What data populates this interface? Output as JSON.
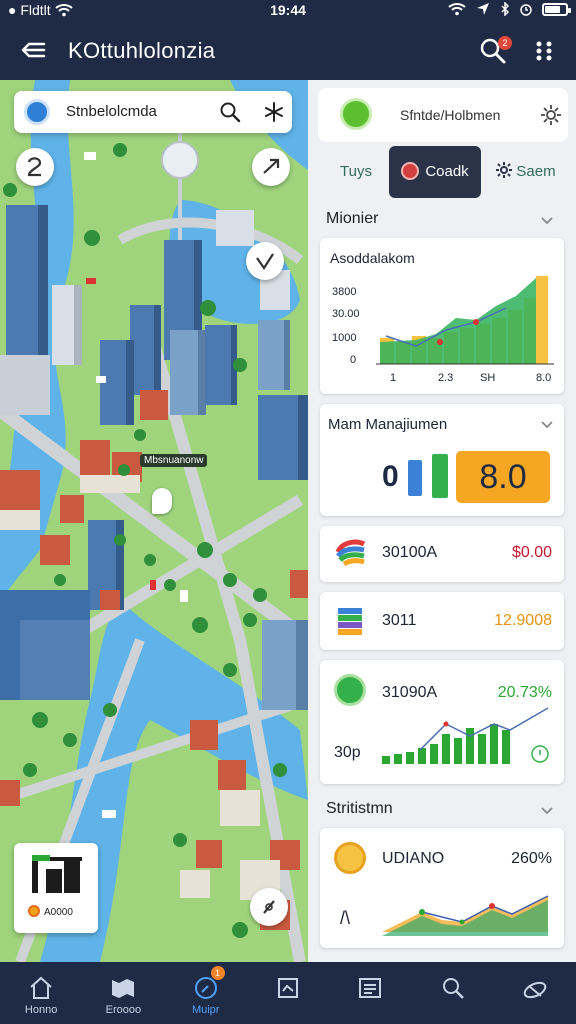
{
  "status_bar": {
    "left_text": "● Fldtlt",
    "time": "19:44"
  },
  "app_bar": {
    "title": "KOttuhlolonzia",
    "notification_count": "2"
  },
  "map": {
    "search_text": "Stnbelolcmda",
    "place_label": "Mbsnuanonw",
    "legend_label": "A0000"
  },
  "panel": {
    "header_text": "Sfntde/Holbmen",
    "tabs": [
      "Tuys",
      "Coadk",
      "Saem"
    ],
    "active_tab": 1,
    "section1_title": "Mionier",
    "chart_card": {
      "title": "Asoddalakom",
      "ytick_labels": [
        "3800",
        "30.00",
        "1000",
        "0"
      ],
      "xtick_labels": [
        "1",
        "2.3",
        "SH",
        "8.0"
      ]
    },
    "management": {
      "title": "Mam Manajiumen",
      "small_value": "0",
      "big_value": "8.0"
    },
    "stat_rows": [
      {
        "icon": "stack-colorful-icon",
        "label": "30100A",
        "value": "$0.00",
        "value_color": "#c8182f"
      },
      {
        "icon": "books-icon",
        "label": "3011",
        "value": "12.9008",
        "value_color": "#e8920f"
      }
    ],
    "trend_card": {
      "label": "31090A",
      "value": "20.73%",
      "sub_label": "30p",
      "value_color": "#2aa632"
    },
    "section2_title": "Stritistmn",
    "bottom_card": {
      "label": "UDIANO",
      "value": "260%",
      "sub_label": "/\\"
    }
  },
  "bottom_nav": [
    {
      "label": "Honno",
      "icon": "home-icon"
    },
    {
      "label": "Eroooo",
      "icon": "map-fold-icon"
    },
    {
      "label": "Muipr",
      "icon": "compass-icon",
      "active": true,
      "badge": "1"
    },
    {
      "label": "",
      "icon": "board-icon"
    },
    {
      "label": "",
      "icon": "list-icon"
    },
    {
      "label": "",
      "icon": "search-icon"
    },
    {
      "label": "",
      "icon": "satellite-icon"
    }
  ],
  "colors": {
    "bar_bg": "#1f2a44",
    "accent_green": "#34b04a",
    "accent_orange": "#f5a623",
    "active_blue": "#4fa2ff"
  }
}
